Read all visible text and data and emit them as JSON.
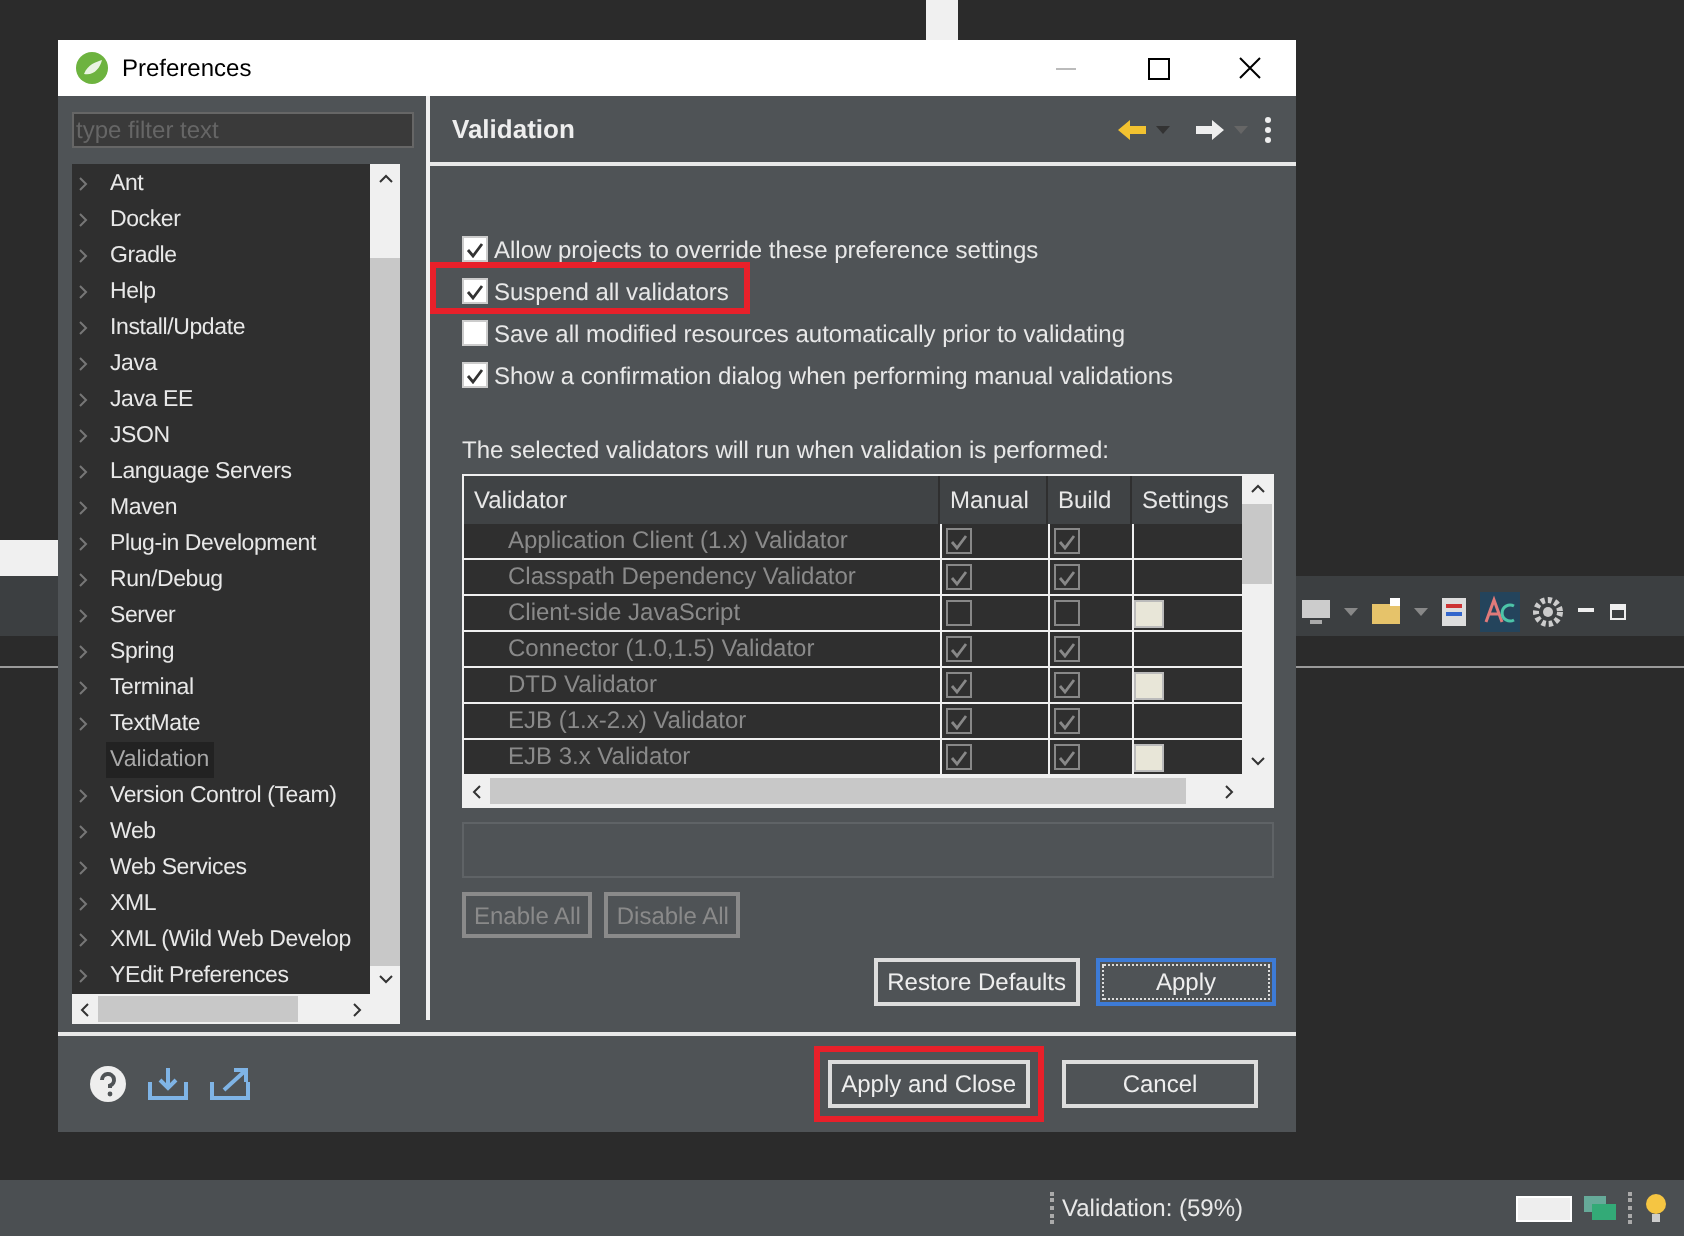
{
  "window": {
    "title": "Preferences"
  },
  "filter": {
    "placeholder": "type filter text"
  },
  "tree": [
    {
      "label": "Ant",
      "expandable": true,
      "selected": false
    },
    {
      "label": "Docker",
      "expandable": true,
      "selected": false
    },
    {
      "label": "Gradle",
      "expandable": true,
      "selected": false
    },
    {
      "label": "Help",
      "expandable": true,
      "selected": false
    },
    {
      "label": "Install/Update",
      "expandable": true,
      "selected": false
    },
    {
      "label": "Java",
      "expandable": true,
      "selected": false
    },
    {
      "label": "Java EE",
      "expandable": true,
      "selected": false
    },
    {
      "label": "JSON",
      "expandable": true,
      "selected": false
    },
    {
      "label": "Language Servers",
      "expandable": true,
      "selected": false
    },
    {
      "label": "Maven",
      "expandable": true,
      "selected": false
    },
    {
      "label": "Plug-in Development",
      "expandable": true,
      "selected": false
    },
    {
      "label": "Run/Debug",
      "expandable": true,
      "selected": false
    },
    {
      "label": "Server",
      "expandable": true,
      "selected": false
    },
    {
      "label": "Spring",
      "expandable": true,
      "selected": false
    },
    {
      "label": "Terminal",
      "expandable": true,
      "selected": false
    },
    {
      "label": "TextMate",
      "expandable": true,
      "selected": false
    },
    {
      "label": "Validation",
      "expandable": false,
      "selected": true
    },
    {
      "label": "Version Control (Team)",
      "expandable": true,
      "selected": false
    },
    {
      "label": "Web",
      "expandable": true,
      "selected": false
    },
    {
      "label": "Web Services",
      "expandable": true,
      "selected": false
    },
    {
      "label": "XML",
      "expandable": true,
      "selected": false
    },
    {
      "label": "XML (Wild Web Develop",
      "expandable": true,
      "selected": false
    },
    {
      "label": "YEdit Preferences",
      "expandable": true,
      "selected": false
    }
  ],
  "page": {
    "title": "Validation"
  },
  "options": [
    {
      "label": "Allow projects to override these preference settings",
      "checked": true,
      "highlighted": false
    },
    {
      "label": "Suspend all validators",
      "checked": true,
      "highlighted": true
    },
    {
      "label": "Save all modified resources automatically prior to validating",
      "checked": false,
      "highlighted": false
    },
    {
      "label": "Show a confirmation dialog when performing manual validations",
      "checked": true,
      "highlighted": false
    }
  ],
  "table_caption": "The selected validators will run when validation is performed:",
  "table": {
    "disabled": true,
    "columns": [
      "Validator",
      "Manual",
      "Build",
      "Settings"
    ],
    "rows": [
      {
        "name": "Application Client (1.x) Validator",
        "manual": true,
        "build": true,
        "settings": false
      },
      {
        "name": "Classpath Dependency Validator",
        "manual": true,
        "build": true,
        "settings": false
      },
      {
        "name": "Client-side JavaScript",
        "manual": false,
        "build": false,
        "settings": true
      },
      {
        "name": "Connector (1.0,1.5) Validator",
        "manual": true,
        "build": true,
        "settings": false
      },
      {
        "name": "DTD Validator",
        "manual": true,
        "build": true,
        "settings": true
      },
      {
        "name": "EJB (1.x-2.x) Validator",
        "manual": true,
        "build": true,
        "settings": false
      },
      {
        "name": "EJB 3.x Validator",
        "manual": true,
        "build": true,
        "settings": true
      }
    ]
  },
  "table_buttons": [
    {
      "label": "Enable All",
      "disabled": true
    },
    {
      "label": "Disable All",
      "disabled": true
    }
  ],
  "page_buttons": [
    {
      "label": "Restore Defaults",
      "focused": false
    },
    {
      "label": "Apply",
      "focused": true
    }
  ],
  "dialog_buttons": [
    {
      "label": "Apply and Close",
      "highlighted": true
    },
    {
      "label": "Cancel",
      "highlighted": false
    }
  ],
  "status_bar": {
    "text": "Validation: (59%)"
  }
}
